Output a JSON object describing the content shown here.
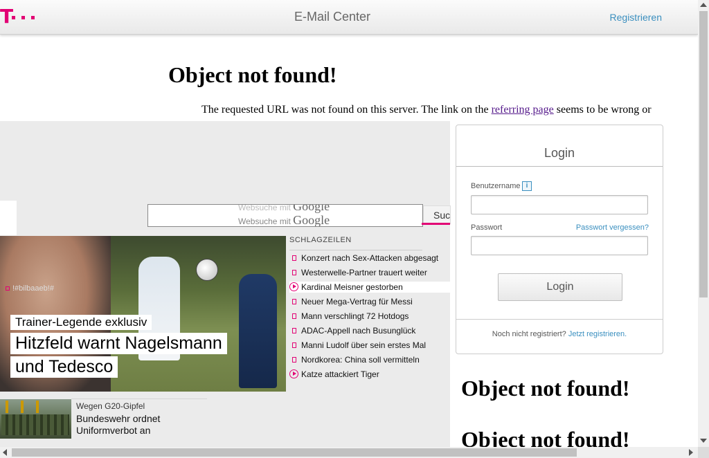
{
  "header": {
    "logo_text": "T",
    "title": "E-Mail Center",
    "register_link": "Registrieren",
    "brand_color": "#e20074",
    "link_color": "#3a8fbf"
  },
  "error": {
    "title": "Object not found!",
    "text_before": "The requested URL was not found on this server. The link on the ",
    "link_text": "referring page",
    "text_after": " seems to be wrong or"
  },
  "search": {
    "placeholder": "Websuche mit",
    "ghost_placeholder": "Websuche mit",
    "google_label": "Google",
    "button_label": "Suc"
  },
  "hero": {
    "tag": "!#bilbaaeb!#",
    "kicker": "Trainer-Legende exklusiv",
    "headline_line1": "Hitzfeld warnt Nagelsmann",
    "headline_line2": "und Tedesco"
  },
  "headlines": {
    "title": "SCHLAGZEILEN",
    "items": [
      {
        "label": "Konzert nach Sex-Attacken abgesagt",
        "icon": "square"
      },
      {
        "label": "Westerwelle-Partner trauert weiter",
        "icon": "square"
      },
      {
        "label": "Kardinal Meisner gestorben",
        "icon": "play"
      },
      {
        "label": "Neuer Mega-Vertrag für Messi",
        "icon": "square"
      },
      {
        "label": "Mann verschlingt 72 Hotdogs",
        "icon": "square"
      },
      {
        "label": "ADAC-Appell nach Busunglück",
        "icon": "square"
      },
      {
        "label": "Manni Ludolf über sein erstes Mal",
        "icon": "square"
      },
      {
        "label": "Nordkorea: China soll vermitteln",
        "icon": "square"
      },
      {
        "label": "Katze attackiert Tiger",
        "icon": "play"
      }
    ]
  },
  "teaser": {
    "kicker": "Wegen G20-Gipfel",
    "title": "Bundeswehr ordnet Uniformverbot an"
  },
  "login": {
    "title": "Login",
    "username_label": "Benutzername",
    "info_icon": "i",
    "password_label": "Passwort",
    "forgot_link": "Passwort vergessen?",
    "username_value": "",
    "password_value": "",
    "button_label": "Login",
    "footer_text": "Noch nicht registriert?",
    "footer_link": "Jetzt registrieren."
  },
  "errors_below": {
    "title1": "Object not found!",
    "title2": "Object not found!"
  }
}
